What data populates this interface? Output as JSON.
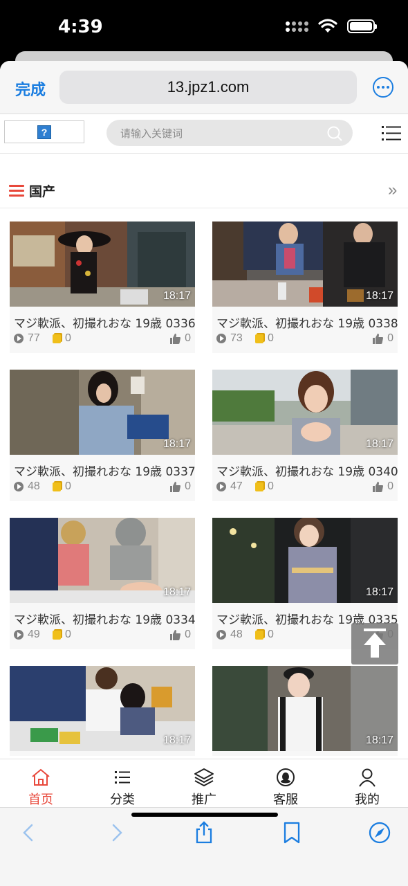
{
  "status_bar": {
    "time": "4:39"
  },
  "browser": {
    "done_label": "完成",
    "url": "13.jpz1.com",
    "more_icon": "ellipsis-circle-icon"
  },
  "site_header": {
    "logo_placeholder": "?",
    "search_placeholder": "请输入关键词",
    "accent": "#e8483b"
  },
  "section": {
    "title": "国产",
    "more_symbol": "»"
  },
  "videos": [
    {
      "title": "マジ軟派、初撮れおな 19歳 0336",
      "duration": "18:17",
      "views": "77",
      "coins": "0",
      "likes": "0"
    },
    {
      "title": "マジ軟派、初撮れおな 19歳 0338",
      "duration": "18:17",
      "views": "73",
      "coins": "0",
      "likes": "0"
    },
    {
      "title": "マジ軟派、初撮れおな 19歳 0337",
      "duration": "18:17",
      "views": "48",
      "coins": "0",
      "likes": "0"
    },
    {
      "title": "マジ軟派、初撮れおな 19歳 0340",
      "duration": "18:17",
      "views": "47",
      "coins": "0",
      "likes": "0"
    },
    {
      "title": "マジ軟派、初撮れおな 19歳 0334",
      "duration": "18:17",
      "views": "49",
      "coins": "0",
      "likes": "0"
    },
    {
      "title": "マジ軟派、初撮れおな 19歳 0335",
      "duration": "18:17",
      "views": "48",
      "coins": "0",
      "likes": "0"
    },
    {
      "duration": "18:17"
    },
    {
      "duration": "18:17"
    }
  ],
  "tabbar": {
    "items": [
      {
        "label": "首页",
        "icon": "home-icon",
        "active": true
      },
      {
        "label": "分类",
        "icon": "list-icon"
      },
      {
        "label": "推广",
        "icon": "layers-icon"
      },
      {
        "label": "客服",
        "icon": "support-icon"
      },
      {
        "label": "我的",
        "icon": "user-icon"
      }
    ]
  },
  "safari_toolbar": {
    "icons": [
      "back-icon",
      "forward-icon",
      "share-icon",
      "bookmarks-icon",
      "compass-icon"
    ],
    "accent": "#1a7de0"
  }
}
